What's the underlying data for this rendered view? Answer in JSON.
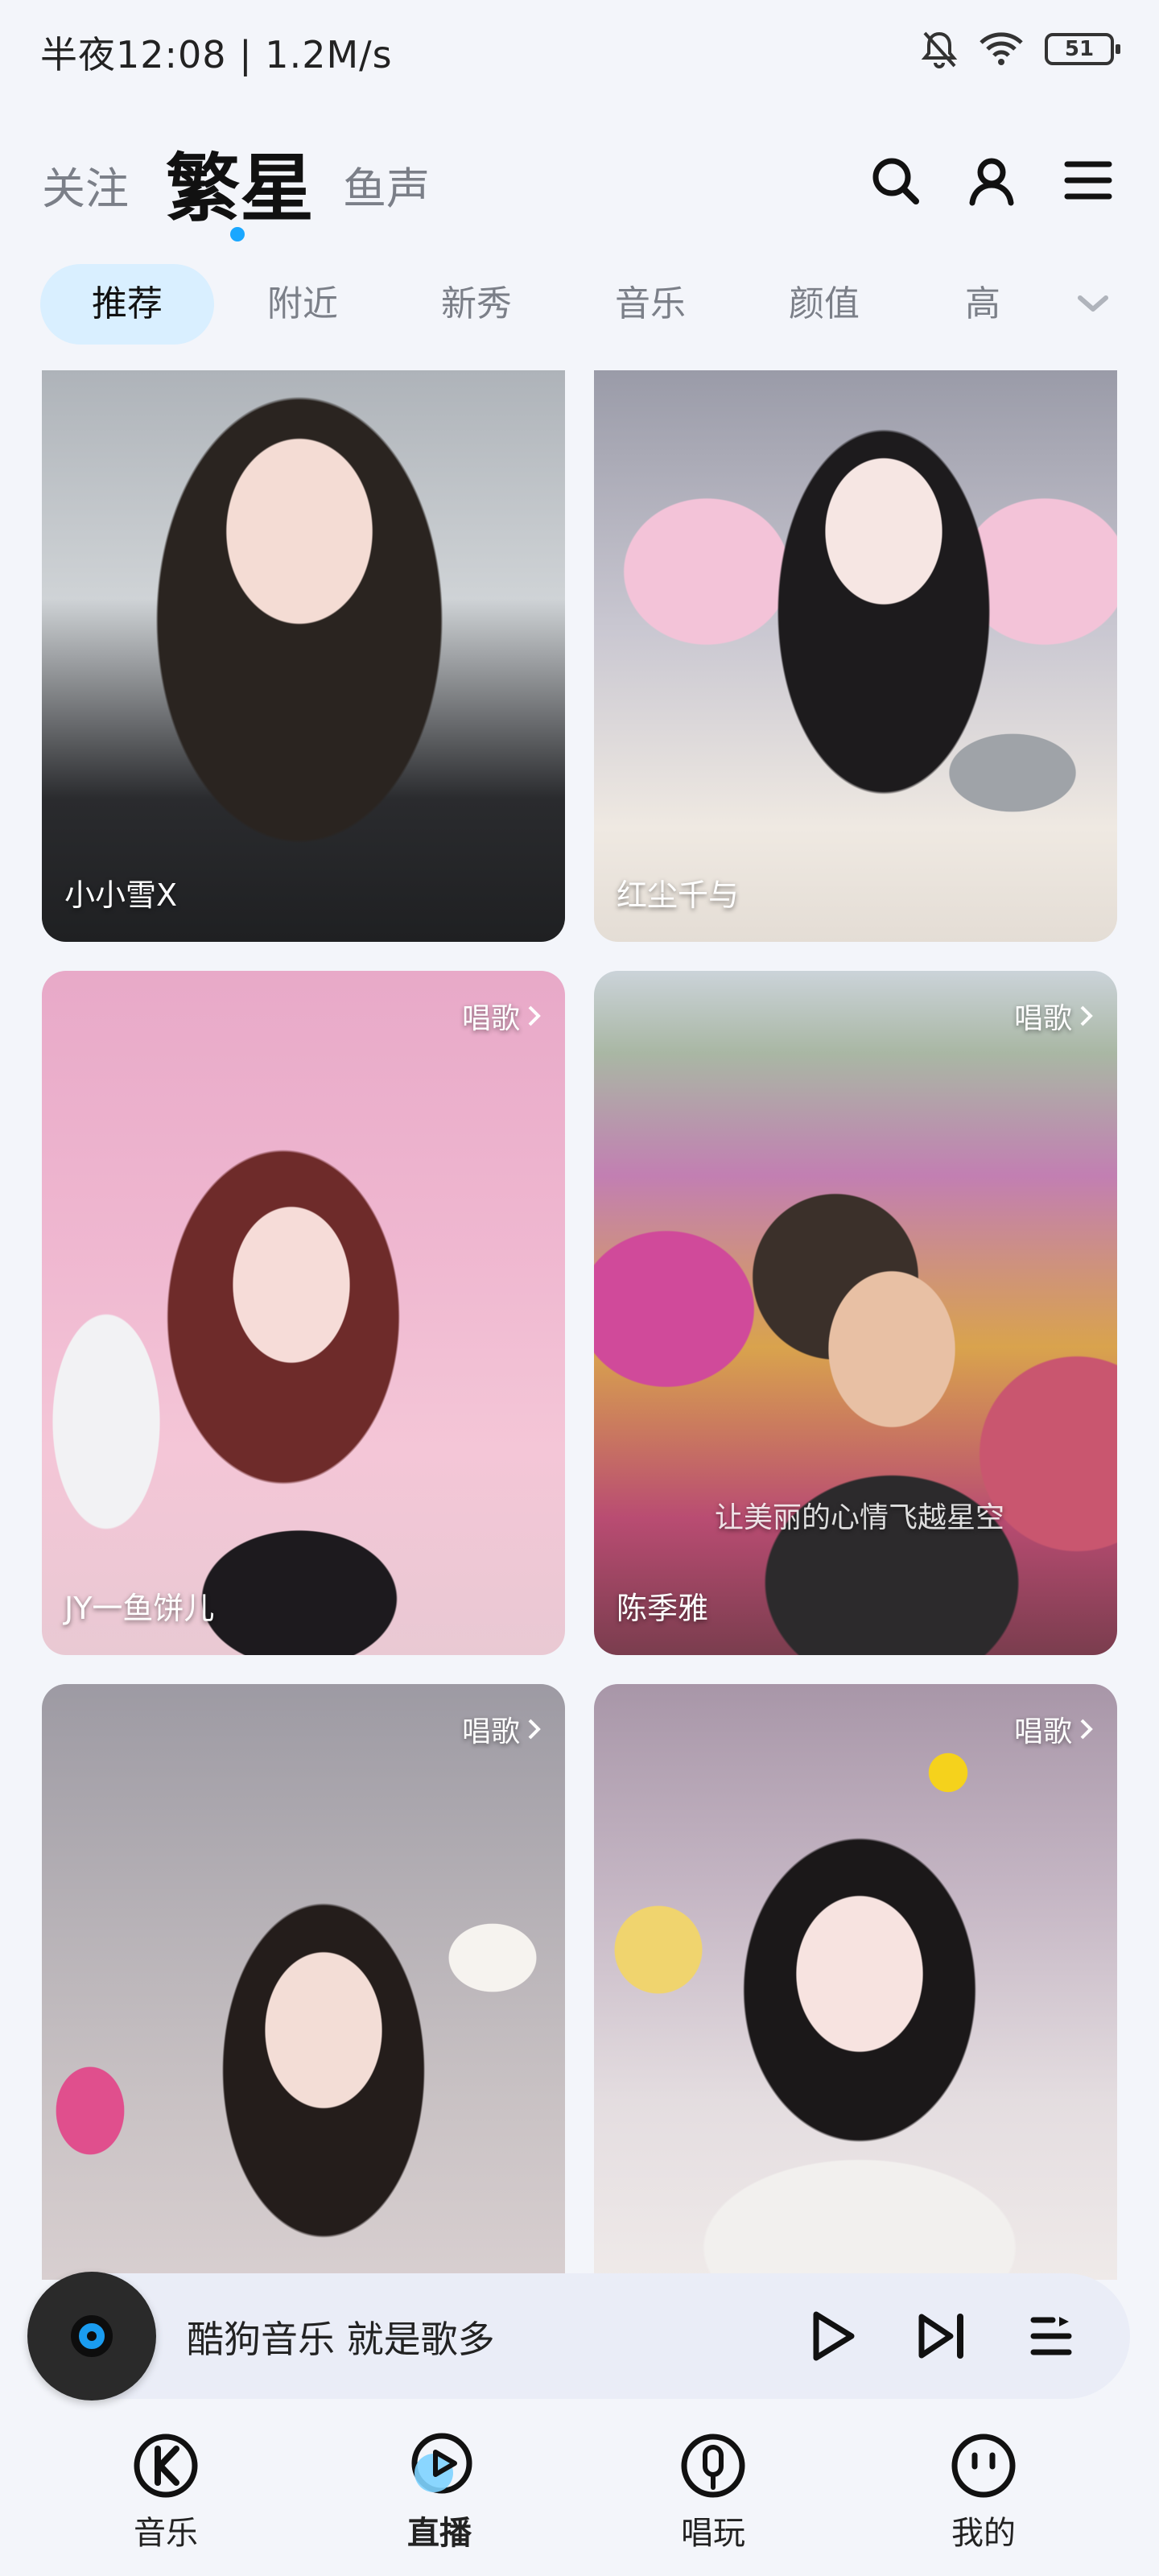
{
  "status_bar": {
    "text": "半夜12:08 | 1.2M/s",
    "battery": "51"
  },
  "top_nav": {
    "tabs": [
      {
        "label": "关注"
      },
      {
        "label": "繁星"
      },
      {
        "label": "鱼声"
      }
    ],
    "active_index": 1
  },
  "categories": [
    "推荐",
    "附近",
    "新秀",
    "音乐",
    "颜值",
    "高"
  ],
  "cards": [
    {
      "name": "小小雪X",
      "tag": ""
    },
    {
      "name": "红尘千与",
      "tag": ""
    },
    {
      "name": "JY一鱼饼儿",
      "tag": "唱歌"
    },
    {
      "name": "陈季雅",
      "tag": "唱歌",
      "overlay": "让美丽的心情飞越星空"
    },
    {
      "name": "",
      "tag": "唱歌"
    },
    {
      "name": "",
      "tag": "唱歌"
    }
  ],
  "player": {
    "title": "酷狗音乐  就是歌多"
  },
  "bottom_nav": [
    {
      "label": "音乐"
    },
    {
      "label": "直播"
    },
    {
      "label": "唱玩"
    },
    {
      "label": "我的"
    }
  ],
  "colors": {
    "accent": "#1aa7ff",
    "active_chip": "#d9efff",
    "background": "#f3f5fa"
  }
}
